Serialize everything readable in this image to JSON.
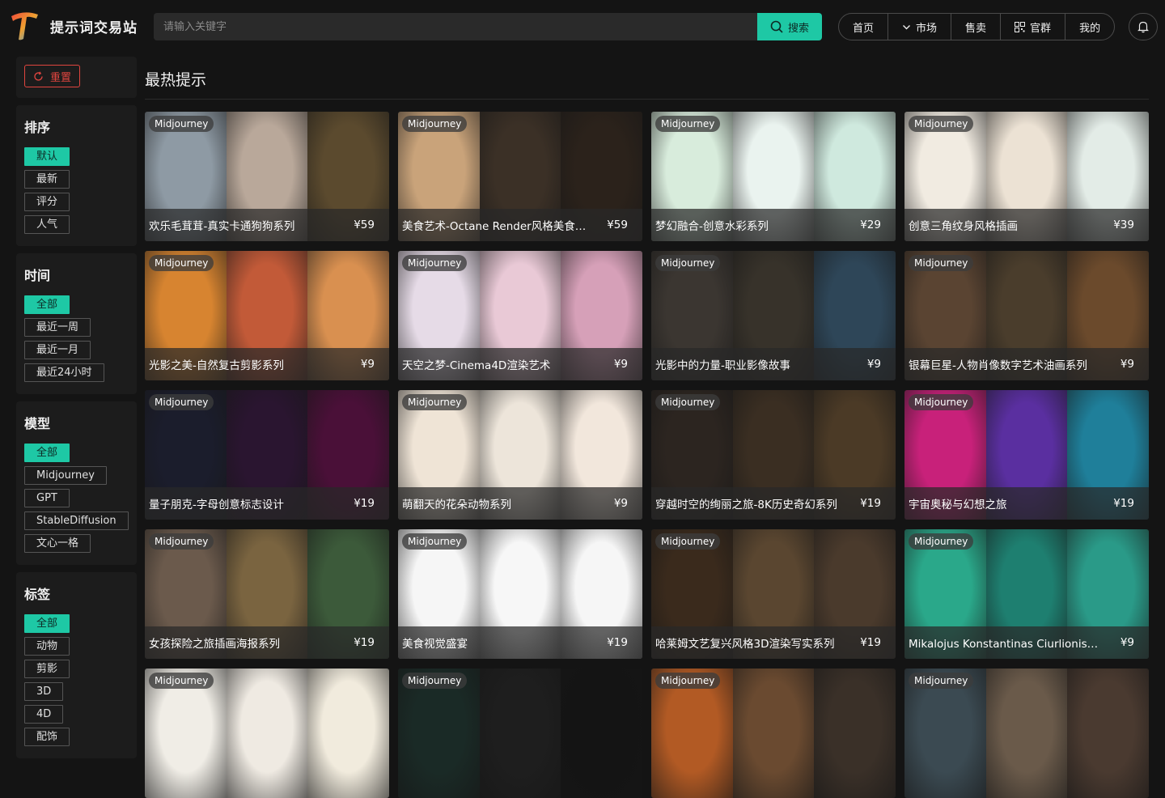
{
  "header": {
    "site_title": "提示词交易站",
    "search_placeholder": "请输入关键字",
    "search_button": "搜索",
    "nav": [
      {
        "label": "首页",
        "icon": ""
      },
      {
        "label": "市场",
        "icon": "chevron-down-icon"
      },
      {
        "label": "售卖",
        "icon": ""
      },
      {
        "label": "官群",
        "icon": "qrcode-icon"
      },
      {
        "label": "我的",
        "icon": ""
      }
    ],
    "accent": "#1ec8a5"
  },
  "sidebar": {
    "reset": "重置",
    "sort": {
      "title": "排序",
      "options": [
        "默认",
        "最新",
        "评分",
        "人气"
      ],
      "selected": 0
    },
    "time": {
      "title": "时间",
      "options": [
        "全部",
        "最近一周",
        "最近一月",
        "最近24小时"
      ],
      "selected": 0
    },
    "model": {
      "title": "模型",
      "options": [
        "全部",
        "Midjourney",
        "GPT",
        "StableDiffusion",
        "文心一格"
      ],
      "selected": 0
    },
    "tags": {
      "title": "标签",
      "options": [
        "全部",
        "动物",
        "剪影",
        "3D",
        "4D",
        "配饰"
      ],
      "selected": 0
    }
  },
  "main": {
    "title": "最热提示",
    "cards": [
      {
        "badge": "Midjourney",
        "title": "欢乐毛茸茸-真实卡通狗狗系列",
        "price": "¥59",
        "colors": [
          "#8e9aa4",
          "#b9a89a",
          "#5b4a2e"
        ]
      },
      {
        "badge": "Midjourney",
        "title": "美食艺术-Octane Render风格美食系...",
        "price": "¥59",
        "colors": [
          "#c9a37a",
          "#3b3026",
          "#2b221b"
        ]
      },
      {
        "badge": "Midjourney",
        "title": "梦幻融合-创意水彩系列",
        "price": "¥29",
        "colors": [
          "#d8ecdc",
          "#eaf3ef",
          "#cfe9de"
        ]
      },
      {
        "badge": "Midjourney",
        "title": "创意三角纹身风格插画",
        "price": "¥39",
        "colors": [
          "#f1ebe1",
          "#ece2d4",
          "#e3ece7"
        ]
      },
      {
        "badge": "Midjourney",
        "title": "光影之美-自然复古剪影系列",
        "price": "¥9",
        "colors": [
          "#d78430",
          "#c25a38",
          "#d99050"
        ]
      },
      {
        "badge": "Midjourney",
        "title": "天空之梦-Cinema4D渲染艺术",
        "price": "¥9",
        "colors": [
          "#e6dbe7",
          "#e9c9d6",
          "#d6a0b8"
        ]
      },
      {
        "badge": "Midjourney",
        "title": "光影中的力量-职业影像故事",
        "price": "¥9",
        "colors": [
          "#3b3631",
          "#37322a",
          "#2e4658"
        ]
      },
      {
        "badge": "Midjourney",
        "title": "银幕巨星-人物肖像数字艺术油画系列",
        "price": "¥9",
        "colors": [
          "#5a4432",
          "#4a3d2c",
          "#6b4a2c"
        ]
      },
      {
        "badge": "Midjourney",
        "title": "量子朋克-字母创意标志设计",
        "price": "¥19",
        "colors": [
          "#1b1d2c",
          "#2a1530",
          "#4a1038"
        ]
      },
      {
        "badge": "Midjourney",
        "title": "萌翻天的花朵动物系列",
        "price": "¥9",
        "colors": [
          "#efe4d6",
          "#ede5da",
          "#f2e7dc"
        ]
      },
      {
        "badge": "Midjourney",
        "title": "穿越时空的绚丽之旅-8K历史奇幻系列",
        "price": "¥19",
        "colors": [
          "#2c2520",
          "#3a2e22",
          "#4b3a26"
        ]
      },
      {
        "badge": "Midjourney",
        "title": "宇宙奥秘与幻想之旅",
        "price": "¥19",
        "colors": [
          "#c8217a",
          "#5a2fa0",
          "#1f7f9a"
        ]
      },
      {
        "badge": "Midjourney",
        "title": "女孩探险之旅插画海报系列",
        "price": "¥19",
        "colors": [
          "#6b5a4c",
          "#7a6440",
          "#3c5a3a"
        ]
      },
      {
        "badge": "Midjourney",
        "title": "美食视觉盛宴",
        "price": "¥19",
        "colors": [
          "#f6f6f6",
          "#f7f7f7",
          "#f6f6f6"
        ]
      },
      {
        "badge": "Midjourney",
        "title": "哈莱姆文艺复兴风格3D渲染写实系列",
        "price": "¥19",
        "colors": [
          "#3a2a1c",
          "#5a4630",
          "#4a3a2c"
        ]
      },
      {
        "badge": "Midjourney",
        "title": "Mikalojus Konstantinas Ciurlionis风...",
        "price": "¥9",
        "colors": [
          "#2aa88a",
          "#1e7f70",
          "#2a9a88"
        ]
      },
      {
        "badge": "Midjourney",
        "title": "",
        "price": "",
        "colors": [
          "#f0ede6",
          "#efeae2",
          "#f1ebdd"
        ]
      },
      {
        "badge": "Midjourney",
        "title": "",
        "price": "",
        "colors": [
          "#1a2a26",
          "#1e1e1e",
          "#141414"
        ]
      },
      {
        "badge": "Midjourney",
        "title": "",
        "price": "",
        "colors": [
          "#b25a24",
          "#6a4a30",
          "#3a3028"
        ]
      },
      {
        "badge": "Midjourney",
        "title": "",
        "price": "",
        "colors": [
          "#3b4a52",
          "#6a5a4a",
          "#4a3a30"
        ]
      }
    ]
  }
}
